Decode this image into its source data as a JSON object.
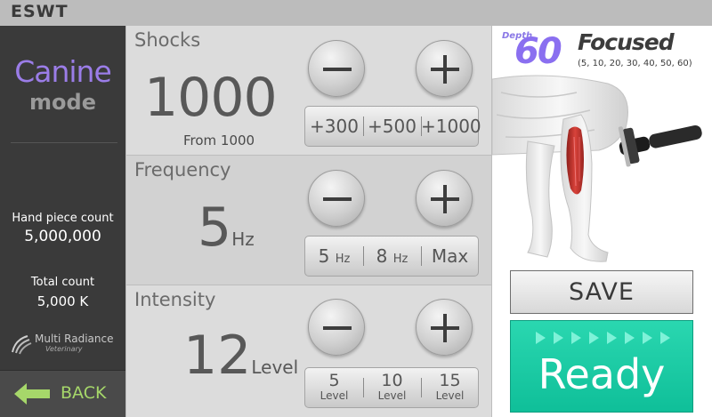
{
  "app": {
    "title": "ESWT"
  },
  "sidebar": {
    "mode_name": "Canine",
    "mode_word": "mode",
    "handpiece_label": "Hand piece  count",
    "handpiece_value": "5,000,000",
    "total_label": "Total count",
    "total_value": "5,000 K",
    "brand_name": "Multi Radiance",
    "brand_sub": "Veterinary",
    "back_label": "BACK"
  },
  "shocks": {
    "title": "Shocks",
    "value": "1000",
    "from_label": "From  1000",
    "presets": [
      "+300",
      "+500",
      "+1000"
    ]
  },
  "frequency": {
    "title": "Frequency",
    "value": "5",
    "unit": "Hz",
    "presets": [
      {
        "num": "5",
        "unit": "Hz"
      },
      {
        "num": "8",
        "unit": "Hz"
      },
      {
        "num": "Max",
        "unit": ""
      }
    ]
  },
  "intensity": {
    "title": "Intensity",
    "value": "12",
    "unit": "Level",
    "presets": [
      {
        "num": "5",
        "word": "Level"
      },
      {
        "num": "10",
        "word": "Level"
      },
      {
        "num": "15",
        "word": "Level"
      }
    ]
  },
  "focus": {
    "depth_label": "Depth",
    "depth_value": "60",
    "title": "Focused",
    "options": "(5, 10, 20, 30, 40, 50, 60)"
  },
  "actions": {
    "save_label": "SAVE",
    "ready_label": "Ready"
  },
  "colors": {
    "accent_purple": "#8a6ff0",
    "ready_green": "#1fcca5",
    "back_green": "#a6d76a",
    "muscle_red": "#c8312b"
  }
}
